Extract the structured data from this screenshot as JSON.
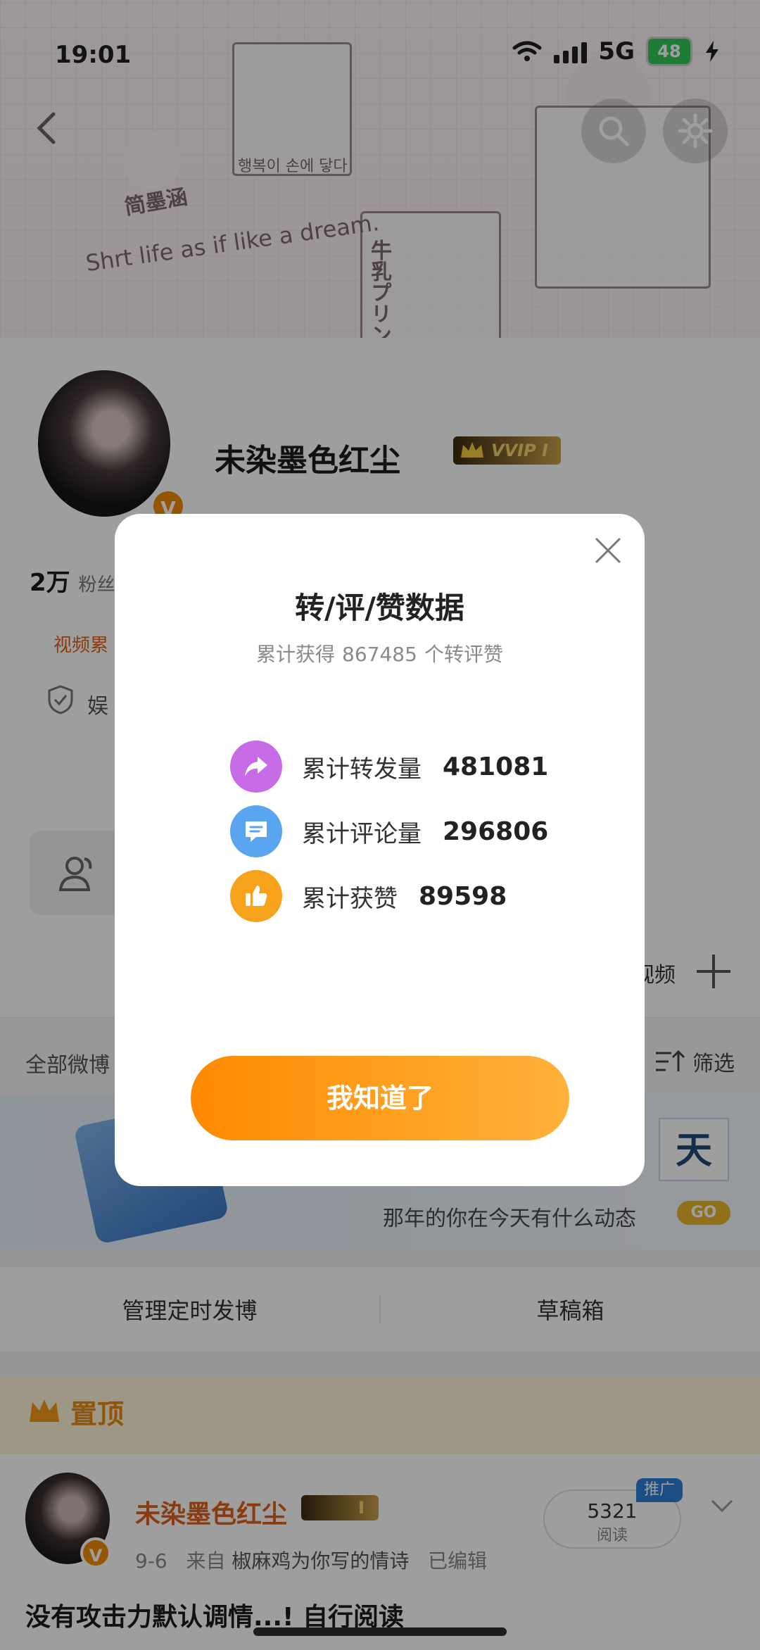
{
  "status_bar": {
    "time": "19:01",
    "network": "5G",
    "battery": "48"
  },
  "profile": {
    "name": "未染墨色红尘",
    "vip_label": "VVIP I",
    "fans_count": "2万",
    "fans_label": "粉丝",
    "video_label": "视频累",
    "entertainment_label": "娱"
  },
  "cover_text": {
    "slogan": "Shrt life as if like a dream.",
    "korean": "행복이 손에 닿다",
    "name_tag": "简墨涵",
    "jp": "牛乳プリン"
  },
  "feed": {
    "filter_all": "全部微博",
    "filter_button": "筛选",
    "video_side": "视频",
    "memory_text": "那年的你在今天有什么动态",
    "memory_go": "GO",
    "memory_day": "天",
    "manage_scheduled": "管理定时发博",
    "drafts": "草稿箱"
  },
  "pinned_post": {
    "section_title": "置顶",
    "author": "未染墨色红尘",
    "vip_level": "I",
    "date": "9-6",
    "from_label": "来自",
    "source": "椒麻鸡为你写的情诗",
    "edited": "已编辑",
    "read_count": "5321",
    "read_label": "阅读",
    "promo_label": "推广",
    "text": "没有攻击力默认调情...!  自行阅读"
  },
  "modal": {
    "title": "转/评/赞数据",
    "subtitle_prefix": "累计获得",
    "subtitle_total": "867485",
    "subtitle_suffix": "个转评赞",
    "stats": [
      {
        "label": "累计转发量",
        "value": "481081",
        "icon": "share-icon",
        "color": "#c86be6"
      },
      {
        "label": "累计评论量",
        "value": "296806",
        "icon": "comment-icon",
        "color": "#5aa5f0"
      },
      {
        "label": "累计获赞",
        "value": "89598",
        "icon": "thumbs-up-icon",
        "color": "#f7a21b"
      }
    ],
    "confirm_label": "我知道了"
  }
}
